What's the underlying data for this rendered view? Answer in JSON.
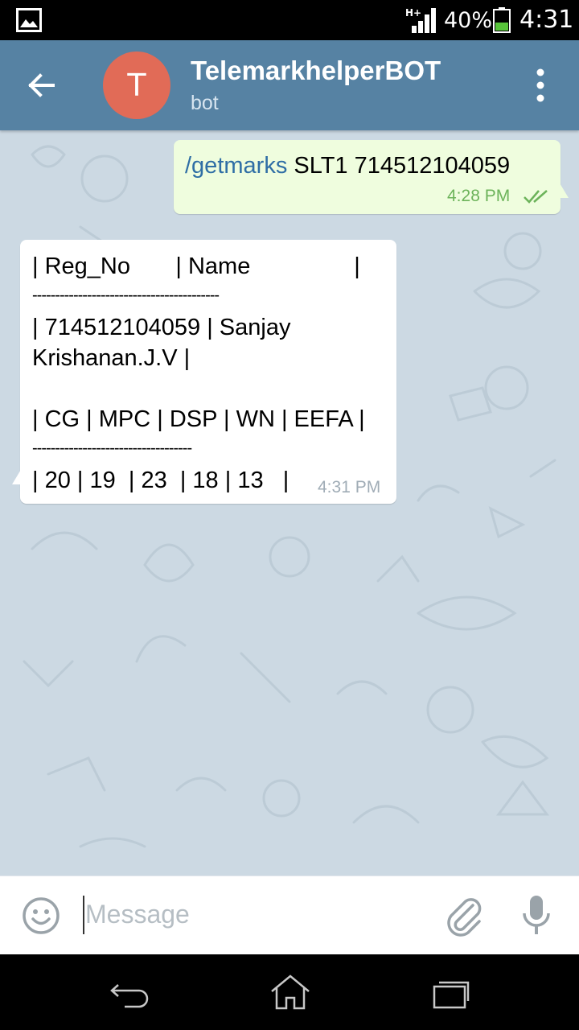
{
  "status_bar": {
    "battery_percent": "40%",
    "time": "4:31",
    "network": "H+"
  },
  "header": {
    "avatar_letter": "T",
    "title": "TelemarkhelperBOT",
    "subtitle": "bot"
  },
  "messages": {
    "outgoing": {
      "command": "/getmarks",
      "text": " SLT1 714512104059",
      "time": "4:28 PM"
    },
    "incoming": {
      "lines": [
        "| Reg_No       | Name                |",
        "-----------------------------------------",
        "| 714512104059 | Sanjay",
        "Krishanan.J.V |",
        "",
        "| CG | MPC | DSP | WN | EEFA |",
        "-----------------------------------",
        "| 20 | 19  | 23  | 18 | 13   |"
      ],
      "time": "4:31 PM"
    }
  },
  "input": {
    "placeholder": "Message"
  },
  "colors": {
    "header": "#5682a3",
    "avatar": "#e16b57",
    "chat_background": "#ccd9e3",
    "outgoing_bubble": "#effdde",
    "incoming_bubble": "#ffffff",
    "command_link": "#2f6ea5",
    "read_checks": "#6cb35a"
  },
  "icons": {
    "status": [
      "gallery-icon",
      "signal-icon",
      "battery-icon"
    ],
    "header": [
      "back-arrow-icon",
      "more-vert-icon"
    ],
    "input": [
      "emoji-icon",
      "paperclip-icon",
      "mic-icon"
    ],
    "navbar": [
      "nav-back-icon",
      "nav-home-icon",
      "nav-recent-icon"
    ]
  }
}
